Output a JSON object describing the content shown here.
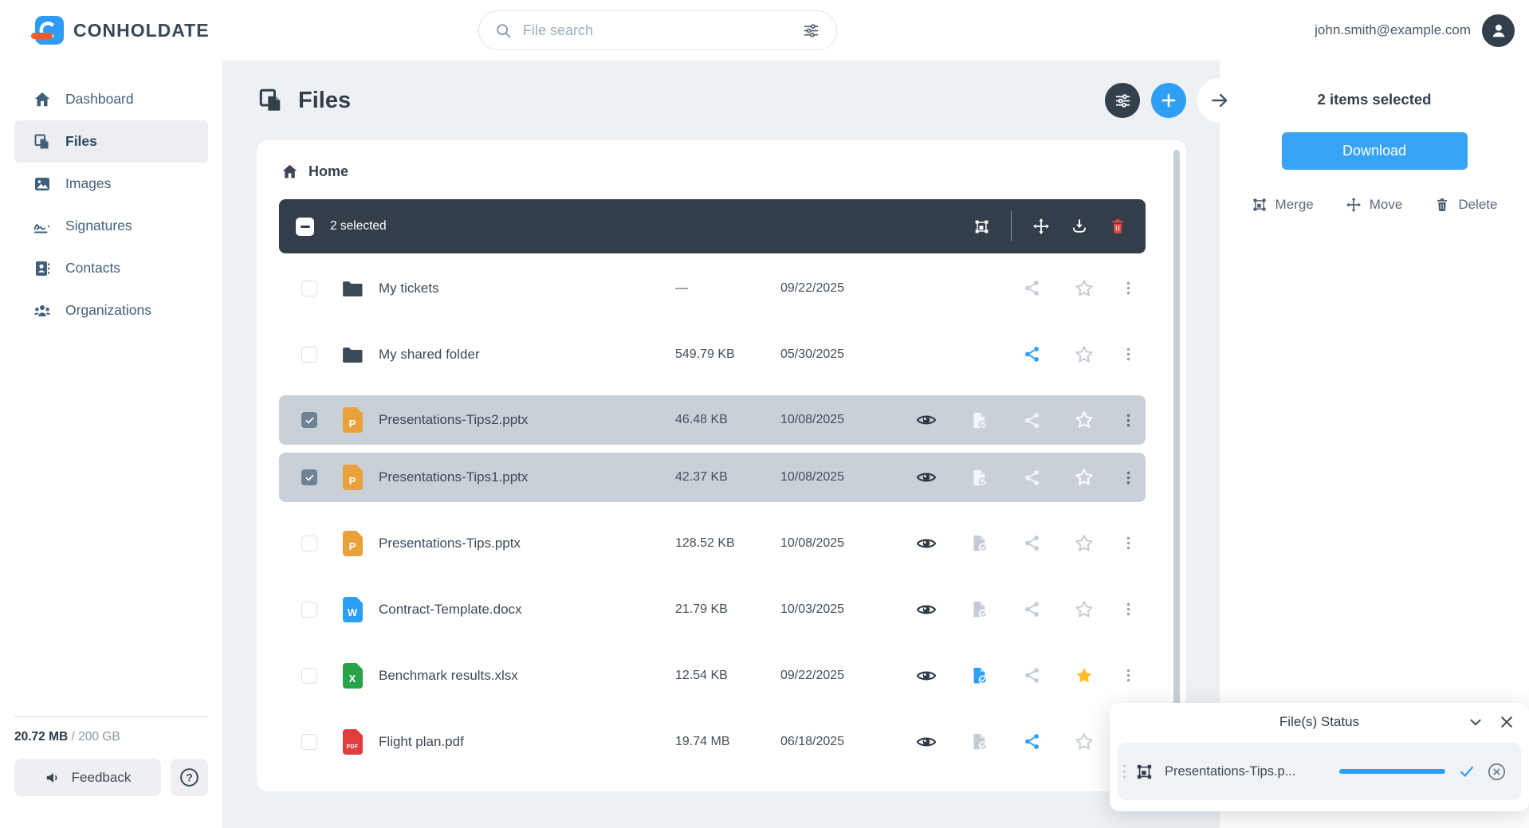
{
  "topbar": {
    "brand": "CONHOLDATE",
    "search": {
      "placeholder": "File search",
      "icon": "search-icon",
      "filter_icon": "sliders-icon"
    },
    "user_email": "john.smith@example.com"
  },
  "sidebar": {
    "items": [
      {
        "label": "Dashboard",
        "icon": "home",
        "active": false
      },
      {
        "label": "Files",
        "icon": "files",
        "active": true
      },
      {
        "label": "Images",
        "icon": "image",
        "active": false
      },
      {
        "label": "Signatures",
        "icon": "signature",
        "active": false
      },
      {
        "label": "Contacts",
        "icon": "contacts",
        "active": false
      },
      {
        "label": "Organizations",
        "icon": "organizations",
        "active": false
      }
    ],
    "storage": {
      "used": "20.72 MB",
      "separator": " / ",
      "total": "200 GB"
    },
    "feedback_label": "Feedback"
  },
  "main": {
    "title": "Files",
    "breadcrumb": "Home",
    "selection_bar": {
      "count_text": "2 selected",
      "tools": [
        "merge",
        "move",
        "download",
        "delete"
      ]
    },
    "rows": [
      {
        "type": "folder",
        "name": "My tickets",
        "size": "—",
        "date": "09/22/2025",
        "selected": false,
        "eye": false,
        "convert": "none",
        "share": "default",
        "star": "default"
      },
      {
        "type": "folder",
        "name": "My shared folder",
        "size": "549.79 KB",
        "date": "05/30/2025",
        "selected": false,
        "eye": false,
        "convert": "none",
        "share": "active",
        "star": "default"
      },
      {
        "type": "pptx",
        "name": "Presentations-Tips2.pptx",
        "size": "46.48 KB",
        "date": "10/08/2025",
        "selected": true,
        "eye": true,
        "convert": "default",
        "share": "default",
        "star": "default"
      },
      {
        "type": "pptx",
        "name": "Presentations-Tips1.pptx",
        "size": "42.37 KB",
        "date": "10/08/2025",
        "selected": true,
        "eye": true,
        "convert": "default",
        "share": "default",
        "star": "default"
      },
      {
        "type": "pptx",
        "name": "Presentations-Tips.pptx",
        "size": "128.52 KB",
        "date": "10/08/2025",
        "selected": false,
        "eye": true,
        "convert": "default",
        "share": "default",
        "star": "default"
      },
      {
        "type": "docx",
        "name": "Contract-Template.docx",
        "size": "21.79 KB",
        "date": "10/03/2025",
        "selected": false,
        "eye": true,
        "convert": "default",
        "share": "default",
        "star": "default"
      },
      {
        "type": "xlsx",
        "name": "Benchmark results.xlsx",
        "size": "12.54 KB",
        "date": "09/22/2025",
        "selected": false,
        "eye": true,
        "convert": "active",
        "share": "default",
        "star": "active"
      },
      {
        "type": "pdf",
        "name": "Flight plan.pdf",
        "size": "19.74 MB",
        "date": "06/18/2025",
        "selected": false,
        "eye": true,
        "convert": "default",
        "share": "active",
        "star": "default"
      }
    ]
  },
  "right_panel": {
    "title": "2 items selected",
    "download_label": "Download",
    "actions": [
      {
        "label": "Merge",
        "icon": "merge"
      },
      {
        "label": "Move",
        "icon": "move"
      },
      {
        "label": "Delete",
        "icon": "trash"
      }
    ]
  },
  "status_popup": {
    "title": "File(s) Status",
    "item": {
      "name": "Presentations-Tips.p...",
      "progress": 100,
      "icon": "merge"
    }
  },
  "colors": {
    "accent": "#2f9ff3",
    "dark_slate": "#333e4a",
    "danger": "#e8493f",
    "star_active": "#ffbe21",
    "file_pptx": "#e9a23b",
    "file_docx": "#2b9ff6",
    "file_xlsx": "#27a349",
    "file_pdf": "#e03e3e",
    "selected_row_bg": "#c9d0d8"
  }
}
